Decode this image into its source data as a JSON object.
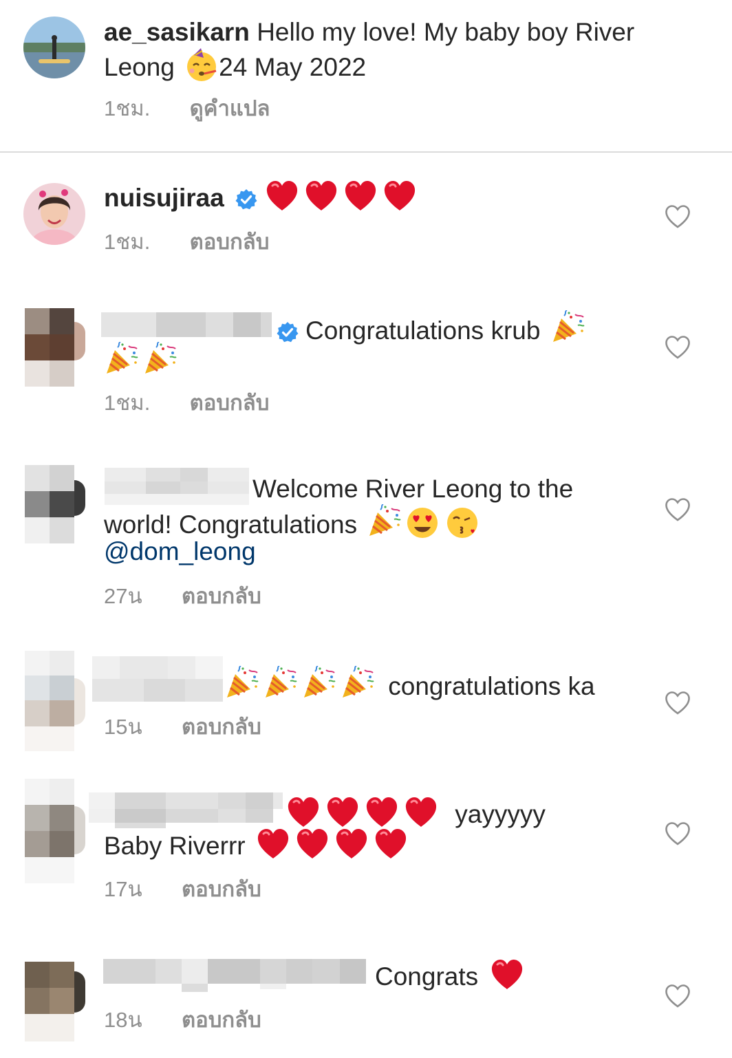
{
  "caption": {
    "username": "ae_sasikarn",
    "text_part1": "Hello my love! My baby boy River",
    "text_part2": "Leong",
    "text_part3": "24 May 2022",
    "time": "1ชม.",
    "translate_label": "ดูคำแปล",
    "emoji": "partying-face-icon"
  },
  "comments": [
    {
      "username": "nuisujiraa",
      "verified": true,
      "emoji": "red-heart-icon x4",
      "time": "1ชม.",
      "reply_label": "ตอบกลับ"
    },
    {
      "username_redacted": true,
      "verified": true,
      "text": "Congratulations krub",
      "emoji": "party-popper-icon x3",
      "time": "1ชม.",
      "reply_label": "ตอบกลับ"
    },
    {
      "username_redacted": true,
      "text_line1": "Welcome River Leong to the",
      "text_line2": "world! Congratulations",
      "mention": "@dom_leong",
      "time": "27น",
      "reply_label": "ตอบกลับ"
    },
    {
      "username_redacted": true,
      "text": "congratulations ka",
      "emoji": "party-popper-icon x4",
      "time": "15น",
      "reply_label": "ตอบกลับ"
    },
    {
      "username_redacted": true,
      "text_line1": "yayyyyy",
      "text_line2": "Baby Riverrr",
      "emoji": "red-heart-icon x8",
      "time": "17น",
      "reply_label": "ตอบกลับ"
    },
    {
      "username_redacted": true,
      "text": "Congrats",
      "emoji": "red-heart-icon",
      "time": "18น",
      "reply_label": "ตอบกลับ"
    }
  ],
  "colors": {
    "text": "#262626",
    "meta": "#8e8e8e",
    "mention": "#00376b",
    "verified": "#3897f0",
    "heart": "#e0102a",
    "divider": "#dbdbdb"
  }
}
